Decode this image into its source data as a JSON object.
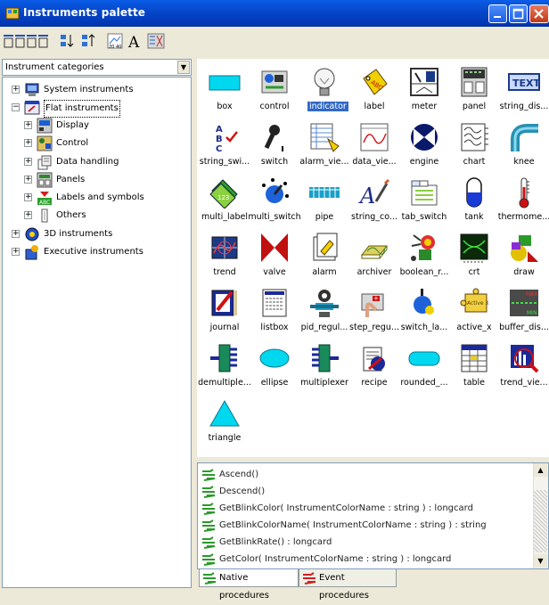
{
  "window": {
    "title": "Instruments palette"
  },
  "tree": {
    "header": "Instrument categories",
    "nodes": [
      {
        "label": "System instruments",
        "expander": "+"
      },
      {
        "label": "Flat instruments",
        "expander": "−"
      },
      {
        "label": "Display",
        "expander": "+"
      },
      {
        "label": "Control",
        "expander": "+"
      },
      {
        "label": "Data handling",
        "expander": "+"
      },
      {
        "label": "Panels",
        "expander": "+"
      },
      {
        "label": "Labels and symbols",
        "expander": "+"
      },
      {
        "label": "Others",
        "expander": "+"
      },
      {
        "label": "3D instruments",
        "expander": "+"
      },
      {
        "label": "Executive instruments",
        "expander": "+"
      }
    ]
  },
  "palette": {
    "items": [
      "box",
      "control",
      "indicator",
      "label",
      "meter",
      "panel",
      "string_dis...",
      "string_swi...",
      "switch",
      "alarm_vie...",
      "data_vie...",
      "engine",
      "chart",
      "knee",
      "multi_label",
      "multi_switch",
      "pipe",
      "string_co...",
      "tab_switch",
      "tank",
      "thermome...",
      "trend",
      "valve",
      "alarm",
      "archiver",
      "boolean_r...",
      "crt",
      "draw",
      "journal",
      "listbox",
      "pid_regul...",
      "step_regu...",
      "switch_la...",
      "active_x",
      "buffer_dis...",
      "demultiple...",
      "ellipse",
      "multiplexer",
      "recipe",
      "rounded_...",
      "table",
      "trend_vie...",
      "triangle"
    ],
    "selected": "indicator",
    "text_icon": "TEXT",
    "abc_icon": "ABC",
    "active_x_icon": "Active X",
    "buffer_max": "MAX",
    "buffer_min": "MIN"
  },
  "procedures": {
    "lines": [
      "Ascend()",
      "Descend()",
      "GetBlinkColor( InstrumentColorName : string ) : longcard",
      "GetBlinkColorName( InstrumentColorName : string ) : string",
      "GetBlinkRate() : longcard",
      "GetColor( InstrumentColorName : string ) : longcard"
    ]
  },
  "tabs": [
    "Native procedures",
    "Event procedures"
  ],
  "colors": {
    "titlebar": "#0a5ce6",
    "selection": "#3169c6",
    "accent_cyan": "#00d8f0"
  }
}
